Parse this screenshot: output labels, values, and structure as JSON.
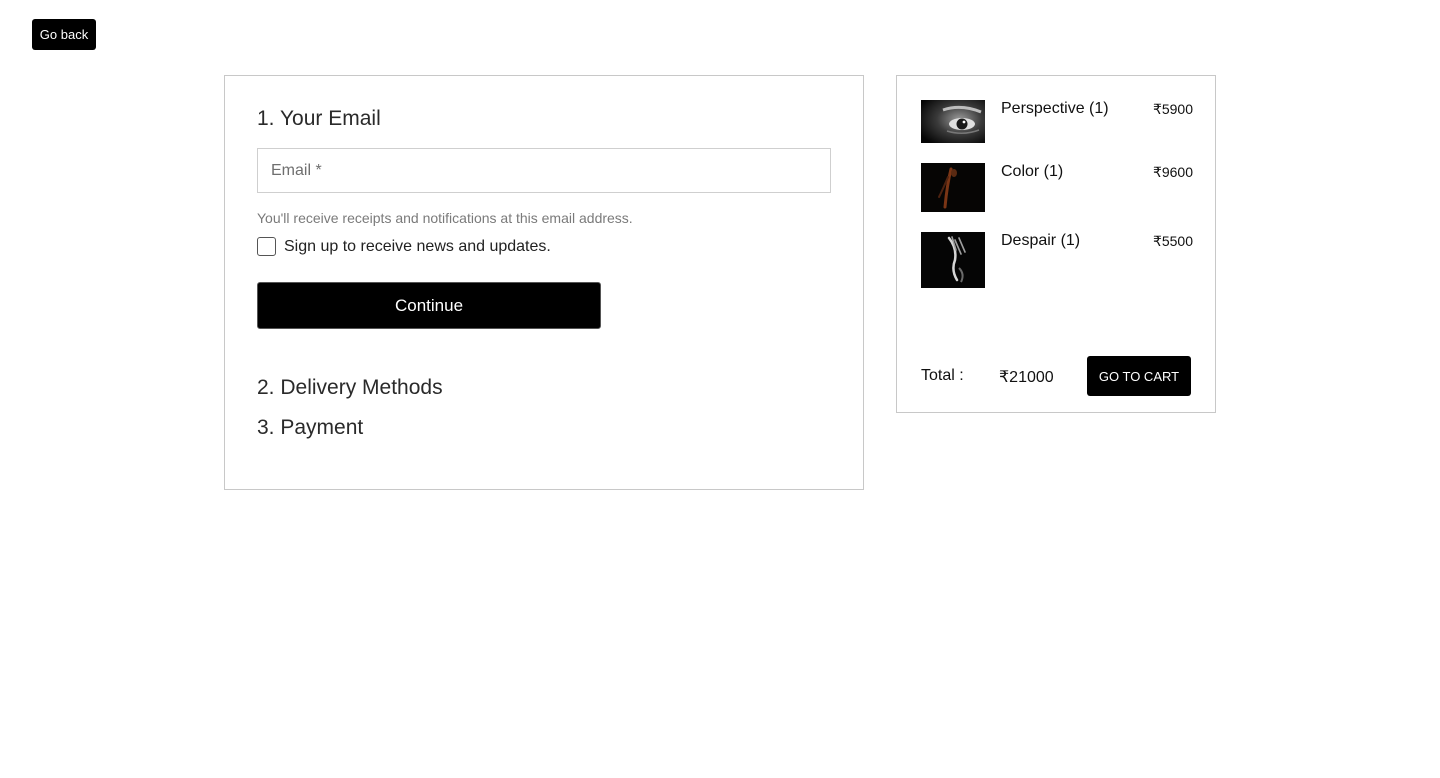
{
  "nav": {
    "go_back_label": "Go back"
  },
  "checkout": {
    "steps": [
      {
        "title": "1. Your Email"
      },
      {
        "title": "2. Delivery Methods"
      },
      {
        "title": "3. Payment"
      }
    ],
    "email": {
      "placeholder": "Email *",
      "value": "",
      "helper": "You'll receive receipts and notifications at this email address."
    },
    "newsletter": {
      "label": "Sign up to receive news and updates.",
      "checked": false
    },
    "continue_label": "Continue"
  },
  "cart": {
    "items": [
      {
        "name": "Perspective (1)",
        "price": "₹5900",
        "image_icon": "eye-portrait-thumbnail"
      },
      {
        "name": "Color (1)",
        "price": "₹9600",
        "image_icon": "dark-figure-thumbnail"
      },
      {
        "name": "Despair (1)",
        "price": "₹5500",
        "image_icon": "hand-face-thumbnail"
      }
    ],
    "total_label": "Total :",
    "total_value": "₹21000",
    "go_to_cart_label": "GO TO CART"
  },
  "colors": {
    "primary_button": "#000000",
    "button_text": "#ffffff",
    "border": "#c8c8c8",
    "helper_text": "#7a7a7a"
  }
}
